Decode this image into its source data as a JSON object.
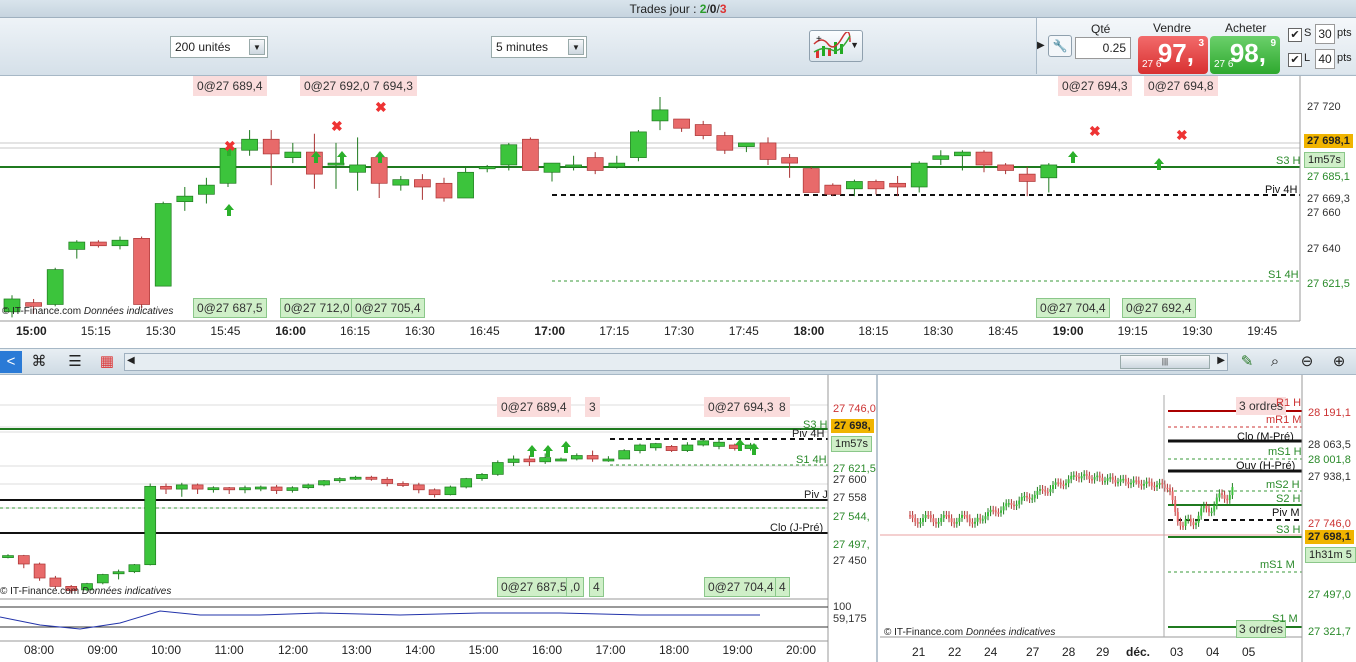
{
  "topbar": {
    "label": "Trades jour : ",
    "wins": "2",
    "sep1": "/",
    "zero": "0",
    "sep2": "/",
    "losses": "3"
  },
  "toolbar": {
    "units": "200 unités",
    "timeframe": "5 minutes",
    "qty_label": "Qté",
    "qty_value": "0.25",
    "sell_label": "Vendre",
    "buy_label": "Acheter",
    "sell_small": "27 6",
    "sell_big": "97,",
    "sell_sup": "3",
    "buy_small": "27 6",
    "buy_big": "98,",
    "buy_sup": "9",
    "s_label": "S",
    "l_label": "L",
    "s_pts": "30",
    "l_pts": "40",
    "pts_label": "pts"
  },
  "main": {
    "copyright": "© IT-Finance.com",
    "copyright_note": "Données indicatives",
    "top_tags": [
      "0@27 689,4",
      "0@27 692,0 7 694,3",
      "0@27 694,3",
      "0@27 694,8"
    ],
    "bottom_tags": [
      "0@27 687,5",
      "0@27 712,0",
      "0@27 705,4",
      "0@27 704,4",
      "0@27 692,4"
    ],
    "price_axis": [
      "27 720",
      "27 698,1",
      "1m57s",
      "27 685,1",
      "27 669,3",
      "27 660",
      "27 640",
      "27 621,5"
    ],
    "levels": {
      "s3h": "S3 H",
      "piv4h": "Piv 4H",
      "s14h": "S1 4H"
    },
    "time_labels": [
      "15:00",
      "15:15",
      "15:30",
      "15:45",
      "16:00",
      "16:15",
      "16:30",
      "16:45",
      "17:00",
      "17:15",
      "17:30",
      "17:45",
      "18:00",
      "18:15",
      "18:30",
      "18:45",
      "19:00",
      "19:15",
      "19:30",
      "19:45"
    ],
    "candles": [
      [
        0,
        27617,
        27624,
        27614,
        27626
      ],
      [
        1,
        27622,
        27620,
        27616,
        27624
      ],
      [
        2,
        27621,
        27640,
        27620,
        27641
      ],
      [
        3,
        27651,
        27655,
        27646,
        27656
      ],
      [
        4,
        27655,
        27653,
        27652,
        27656
      ],
      [
        5,
        27653,
        27656,
        27651,
        27658
      ],
      [
        6,
        27657,
        27621,
        27619,
        27658
      ],
      [
        7,
        27631,
        27676,
        27631,
        27677
      ],
      [
        8,
        27677,
        27680,
        27672,
        27685
      ],
      [
        9,
        27681,
        27686,
        27676,
        27690
      ],
      [
        10,
        27687,
        27706,
        27685,
        27709
      ],
      [
        11,
        27705,
        27711,
        27702,
        27716
      ],
      [
        12,
        27711,
        27703,
        27686,
        27716
      ],
      [
        13,
        27701,
        27704,
        27698,
        27709
      ],
      [
        14,
        27704,
        27692,
        27684,
        27714
      ],
      [
        15,
        27697,
        27698,
        27684,
        27709
      ],
      [
        16,
        27693,
        27697,
        27683,
        27712
      ],
      [
        17,
        27701,
        27687,
        27679,
        27704
      ],
      [
        18,
        27686,
        27689,
        27683,
        27691
      ],
      [
        19,
        27689,
        27685,
        27678,
        27692
      ],
      [
        20,
        27687,
        27679,
        27677,
        27690
      ],
      [
        21,
        27679,
        27693,
        27679,
        27696
      ],
      [
        22,
        27695,
        27696,
        27693,
        27697
      ],
      [
        23,
        27697,
        27708,
        27694,
        27709
      ],
      [
        24,
        27711,
        27694,
        27694,
        27712
      ],
      [
        25,
        27693,
        27698,
        27688,
        27698
      ],
      [
        26,
        27696,
        27697,
        27694,
        27702
      ],
      [
        27,
        27701,
        27694,
        27692,
        27704
      ],
      [
        28,
        27696,
        27698,
        27695,
        27702
      ],
      [
        29,
        27701,
        27715,
        27699,
        27716
      ],
      [
        30,
        27721,
        27727,
        27716,
        27734
      ],
      [
        31,
        27722,
        27717,
        27715,
        27722
      ],
      [
        32,
        27719,
        27713,
        27711,
        27721
      ],
      [
        33,
        27713,
        27705,
        27703,
        27715
      ],
      [
        34,
        27707,
        27709,
        27704,
        27709
      ],
      [
        35,
        27709,
        27700,
        27697,
        27712
      ],
      [
        36,
        27701,
        27698,
        27690,
        27703
      ],
      [
        37,
        27695,
        27682,
        27682,
        27696
      ],
      [
        38,
        27686,
        27681,
        27680,
        27687
      ],
      [
        39,
        27684,
        27688,
        27680,
        27689
      ],
      [
        40,
        27688,
        27684,
        27681,
        27689
      ],
      [
        41,
        27687,
        27685,
        27680,
        27691
      ],
      [
        42,
        27685,
        27698,
        27682,
        27699
      ],
      [
        43,
        27700,
        27702,
        27697,
        27705
      ],
      [
        44,
        27702,
        27704,
        27694,
        27705
      ],
      [
        45,
        27704,
        27697,
        27693,
        27705
      ],
      [
        46,
        27697,
        27694,
        27692,
        27698
      ],
      [
        47,
        27692,
        27688,
        27680,
        27696
      ],
      [
        48,
        27690,
        27697,
        27682,
        27698
      ]
    ],
    "ylim": [
      27612,
      27740
    ]
  },
  "navbar": {
    "scroll_label": "|||"
  },
  "bottom_left": {
    "copyright": "© IT-Finance.com",
    "copyright_note": "Données indicatives",
    "top_tags": [
      "0@27 689,4",
      "3",
      "0@27 694,3",
      "8"
    ],
    "bottom_tags": [
      "0@27 687,5",
      ",0",
      "4",
      "0@27 704,4",
      "4"
    ],
    "price_axis": [
      "27 746,0",
      "27 698,",
      "S3 H",
      "1m57s",
      "S1 4H",
      "27 621,5",
      "27 600",
      "27 558",
      "27 544,",
      "27 497,",
      "27 450"
    ],
    "levels": {
      "piv4h": "Piv 4H",
      "piv": "Piv J",
      "clo": "Clo (J-Pré)"
    },
    "time_labels": [
      "08:00",
      "09:00",
      "10:00",
      "11:00",
      "12:00",
      "13:00",
      "14:00",
      "15:00",
      "16:00",
      "17:00",
      "18:00",
      "19:00",
      "20:00"
    ],
    "osc_labels": [
      "100",
      "59,175"
    ],
    "candles": [
      [
        0,
        27502,
        27502,
        27498,
        27504
      ],
      [
        1,
        27502,
        27490,
        27484,
        27503
      ],
      [
        2,
        27490,
        27470,
        27466,
        27492
      ],
      [
        3,
        27470,
        27458,
        27455,
        27473
      ],
      [
        4,
        27458,
        27452,
        27448,
        27460
      ],
      [
        5,
        27453,
        27462,
        27451,
        27463
      ],
      [
        6,
        27463,
        27475,
        27461,
        27476
      ],
      [
        7,
        27476,
        27479,
        27468,
        27482
      ],
      [
        8,
        27479,
        27489,
        27477,
        27490
      ],
      [
        9,
        27489,
        27601,
        27488,
        27605
      ],
      [
        10,
        27601,
        27597,
        27590,
        27605
      ],
      [
        11,
        27597,
        27603,
        27586,
        27606
      ],
      [
        12,
        27603,
        27597,
        27590,
        27605
      ],
      [
        13,
        27597,
        27599,
        27592,
        27601
      ],
      [
        14,
        27599,
        27596,
        27590,
        27600
      ],
      [
        15,
        27596,
        27599,
        27591,
        27602
      ],
      [
        16,
        27599,
        27600,
        27594,
        27602
      ],
      [
        17,
        27600,
        27595,
        27590,
        27603
      ],
      [
        18,
        27595,
        27599,
        27592,
        27601
      ],
      [
        19,
        27599,
        27603,
        27597,
        27605
      ],
      [
        20,
        27603,
        27609,
        27601,
        27610
      ],
      [
        21,
        27609,
        27612,
        27606,
        27614
      ],
      [
        22,
        27612,
        27614,
        27610,
        27616
      ],
      [
        23,
        27614,
        27611,
        27609,
        27616
      ],
      [
        24,
        27611,
        27605,
        27601,
        27614
      ],
      [
        25,
        27605,
        27603,
        27600,
        27608
      ],
      [
        26,
        27603,
        27596,
        27591,
        27606
      ],
      [
        27,
        27596,
        27589,
        27585,
        27598
      ],
      [
        28,
        27589,
        27600,
        27588,
        27602
      ],
      [
        29,
        27600,
        27612,
        27598,
        27613
      ],
      [
        30,
        27612,
        27618,
        27609,
        27620
      ],
      [
        31,
        27618,
        27635,
        27616,
        27638
      ],
      [
        32,
        27635,
        27640,
        27630,
        27645
      ],
      [
        33,
        27640,
        27636,
        27630,
        27645
      ],
      [
        34,
        27636,
        27642,
        27633,
        27648
      ],
      [
        35,
        27640,
        27640,
        27637,
        27642
      ],
      [
        36,
        27640,
        27645,
        27638,
        27648
      ],
      [
        37,
        27645,
        27640,
        27636,
        27652
      ],
      [
        38,
        27640,
        27640,
        27636,
        27644
      ],
      [
        39,
        27640,
        27652,
        27640,
        27654
      ],
      [
        40,
        27652,
        27660,
        27648,
        27662
      ],
      [
        41,
        27656,
        27662,
        27652,
        27663
      ],
      [
        42,
        27658,
        27652,
        27650,
        27660
      ],
      [
        43,
        27652,
        27660,
        27650,
        27664
      ],
      [
        44,
        27660,
        27666,
        27658,
        27668
      ],
      [
        45,
        27658,
        27664,
        27654,
        27668
      ],
      [
        46,
        27660,
        27655,
        27652,
        27662
      ],
      [
        47,
        27655,
        27660,
        27652,
        27663
      ]
    ],
    "ylim": [
      27440,
      27760
    ]
  },
  "bottom_right": {
    "copyright": "© IT-Finance.com",
    "copyright_note": "Données indicatives",
    "tags": [
      "3 ordres",
      "3 ordres"
    ],
    "price_axis": [
      "28 191,1",
      "28 063,5",
      "28 001,8",
      "27 938,1",
      "27 746,0",
      "27 698,1",
      "1h31m 5",
      "27 497,0",
      "27 321,7"
    ],
    "levels": [
      "R1 H",
      "mR1 M",
      "Clo (M-Pré)",
      "mS1 H",
      "Ouv (H-Pré)",
      "mS2 H",
      "S2 H",
      "Piv M",
      "S3 H",
      "mS1 M",
      "S1 M"
    ],
    "time_labels": [
      "21",
      "22",
      "24",
      "27",
      "28",
      "29",
      "déc.",
      "03",
      "04",
      "05"
    ]
  }
}
